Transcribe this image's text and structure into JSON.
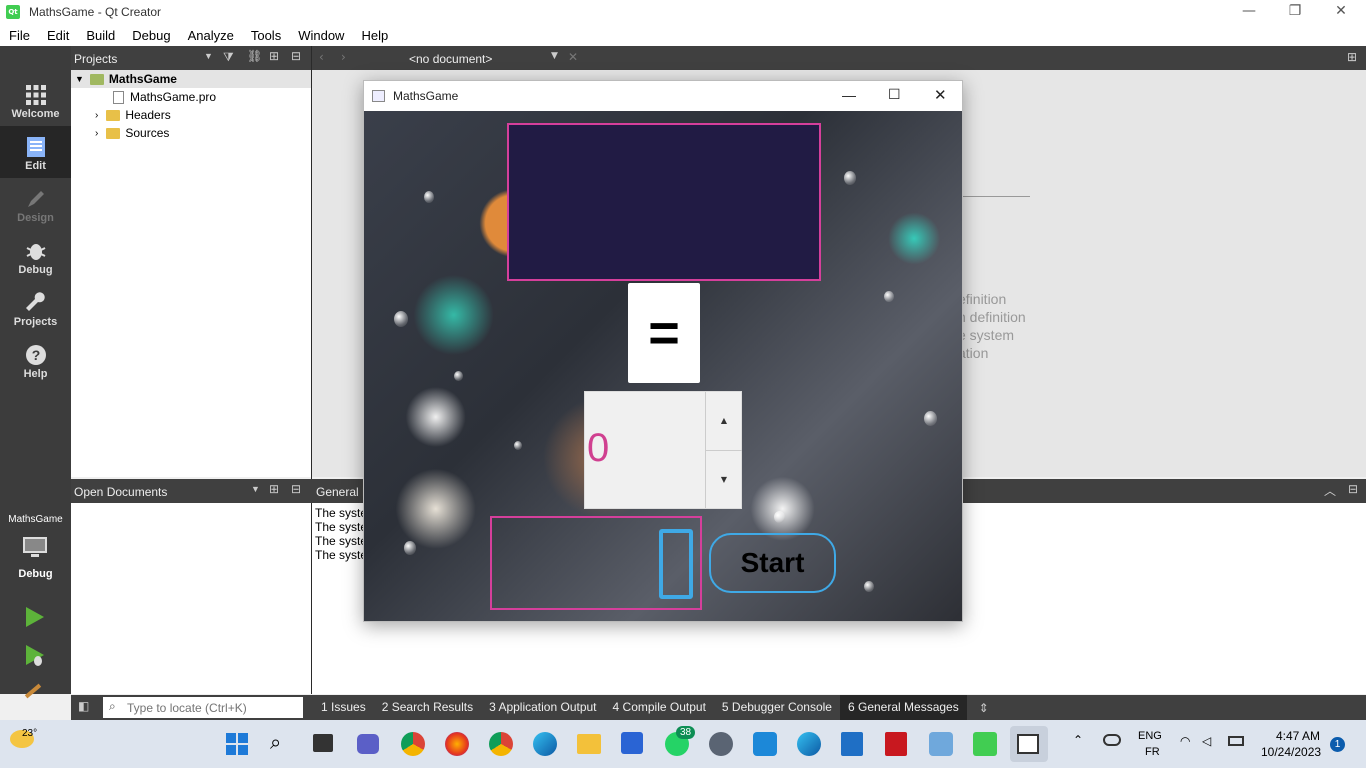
{
  "window": {
    "title": "MathsGame - Qt Creator"
  },
  "menu": [
    "File",
    "Edit",
    "Build",
    "Debug",
    "Analyze",
    "Tools",
    "Window",
    "Help"
  ],
  "modes": [
    {
      "label": "Welcome",
      "icon": "grid-icon"
    },
    {
      "label": "Edit",
      "icon": "document-icon"
    },
    {
      "label": "Design",
      "icon": "pen-icon"
    },
    {
      "label": "Debug",
      "icon": "bug-icon"
    },
    {
      "label": "Projects",
      "icon": "wrench-icon"
    },
    {
      "label": "Help",
      "icon": "help-icon"
    }
  ],
  "kit": {
    "project": "MathsGame",
    "build": "Debug"
  },
  "projects": {
    "header": "Projects",
    "root": "MathsGame",
    "items": [
      "MathsGame.pro",
      "Headers",
      "Sources"
    ]
  },
  "editor": {
    "doc_selector": "<no document>",
    "hints": [
      "efinition",
      "n definition",
      "e system",
      "ation"
    ]
  },
  "open_documents": {
    "header": "Open Documents"
  },
  "general": {
    "header": "General M",
    "lines": [
      "The syste",
      "The syste",
      "The syste",
      "The syste"
    ]
  },
  "statusbar": {
    "locate_placeholder": "Type to locate (Ctrl+K)",
    "tabs": [
      "1  Issues",
      "2  Search Results",
      "3  Application Output",
      "4  Compile Output",
      "5  Debugger Console",
      "6  General Messages"
    ]
  },
  "game": {
    "title": "MathsGame",
    "display_text": "",
    "equals": "=",
    "spin_value": "0",
    "start_label": "Start"
  },
  "taskbar": {
    "weather": "23°",
    "badge_whatsapp": "38",
    "lang": "ENG",
    "lang2": "FR",
    "time": "4:47 AM",
    "date": "10/24/2023",
    "notif": "1"
  }
}
